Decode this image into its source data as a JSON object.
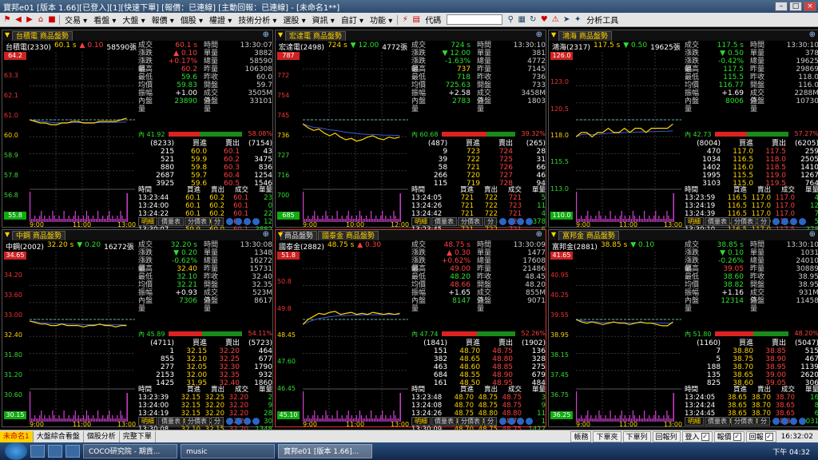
{
  "window": {
    "title": "寶邦e01 [版本 1.66][已登入][1][快速下單] [報價：已連線] [主動回報：已連線] - [未命名1**]"
  },
  "menu": {
    "items": [
      "交易",
      "看盤",
      "大盤",
      "報價",
      "個股",
      "權證",
      "技術分析",
      "選股",
      "資訊",
      "自訂",
      "功能"
    ],
    "code_label": "代碼",
    "analysis_tools": "分析工具"
  },
  "panels": [
    {
      "header": [
        "台積電 商品盤勢"
      ],
      "info": {
        "name": "台積電(2330)",
        "price": "60.1 s",
        "change": "▲ 0.10",
        "volume": "58590張",
        "dir": "up"
      },
      "y_labels": [
        "64.2",
        "63.3",
        "62.1",
        "61.0",
        "60.0",
        "58.9",
        "57.8",
        "56.8",
        "55.8"
      ],
      "x_labels": [
        "9:00",
        "11:00",
        "13:00"
      ],
      "quote": [
        [
          "成交",
          "60.1 s",
          "r",
          "時間",
          "13:30:07"
        ],
        [
          "漲跌",
          "▲ 0.10",
          "r",
          "單量",
          "3882"
        ],
        [
          "漲跌幅",
          "+0.17%",
          "r",
          "總量",
          "58590"
        ],
        [
          "最高",
          "60.2",
          "r",
          "昨量",
          "106308"
        ],
        [
          "最低",
          "59.6",
          "g",
          "昨收",
          "60.0"
        ],
        [
          "均價",
          "59.83",
          "g",
          "開盤",
          "59.7"
        ],
        [
          "振幅",
          "+1.00",
          "w",
          "成交值",
          "3505M"
        ],
        [
          "內盤量",
          "23890",
          "g",
          "外盤量",
          "33101"
        ]
      ],
      "ratio": {
        "left": "41.92",
        "right": "58.08%",
        "fill": 0.42
      },
      "orderbook": [
        [
          "(8233)",
          "買進",
          "賣出",
          "(7154)"
        ],
        [
          "215",
          "60.0",
          "60.1",
          "43"
        ],
        [
          "521",
          "59.9",
          "60.2",
          "3475"
        ],
        [
          "880",
          "59.8",
          "60.3",
          "836"
        ],
        [
          "2687",
          "59.7",
          "60.4",
          "1254"
        ],
        [
          "3925",
          "59.6",
          "60.5",
          "1546"
        ]
      ],
      "ticks_header": [
        "時間",
        "買進",
        "賣出",
        "成交",
        "單量"
      ],
      "ticks": [
        [
          "13:23:44",
          "60.1",
          "60.2",
          "60.1",
          "23"
        ],
        [
          "13:24:00",
          "60.1",
          "60.2",
          "60.1",
          "0"
        ],
        [
          "13:24:22",
          "60.1",
          "60.2",
          "60.1",
          "22"
        ],
        [
          "13:24:42",
          "60.0",
          "60.1",
          "60.1",
          "12"
        ],
        [
          "13:30:07",
          "59.9",
          "60.0",
          "60.1",
          "3882"
        ]
      ],
      "series": [
        60.0,
        59.9,
        59.8,
        59.8,
        59.7,
        59.7,
        59.8,
        59.8,
        59.9,
        59.9,
        59.8,
        59.8,
        59.8,
        59.9,
        59.9,
        59.9,
        59.9,
        60.0,
        60.1
      ],
      "ref": 60.0,
      "ymin": 55.8,
      "ymax": 64.2,
      "active": false
    },
    {
      "header": [
        "宏達電 商品盤勢"
      ],
      "info": {
        "name": "宏達電(2498)",
        "price": "724 s",
        "change": "▼ 12.00",
        "volume": "4772張",
        "dir": "down"
      },
      "y_labels": [
        "787",
        "772",
        "754",
        "745",
        "736",
        "727",
        "716",
        "700",
        "685"
      ],
      "x_labels": [
        "9:00",
        "10:00",
        "12:00"
      ],
      "quote": [
        [
          "成交",
          "724 s",
          "g",
          "時間",
          "13:30:10"
        ],
        [
          "漲跌",
          "▼ 12.00",
          "g",
          "單量",
          "381"
        ],
        [
          "漲跌幅",
          "-1.63%",
          "g",
          "總量",
          "4772"
        ],
        [
          "最高",
          "737",
          "y",
          "昨量",
          "7145"
        ],
        [
          "最低",
          "718",
          "g",
          "昨收",
          "736"
        ],
        [
          "均價",
          "725.63",
          "g",
          "開盤",
          "733"
        ],
        [
          "振幅",
          "+2.58",
          "w",
          "成交值",
          "3458M"
        ],
        [
          "內盤量",
          "2783",
          "g",
          "外盤量",
          "1803"
        ]
      ],
      "ratio": {
        "left": "60.68",
        "right": "39.32%",
        "fill": 0.61
      },
      "orderbook": [
        [
          "(487)",
          "買進",
          "賣出",
          "(265)"
        ],
        [
          "9",
          "723",
          "724",
          "28"
        ],
        [
          "39",
          "722",
          "725",
          "31"
        ],
        [
          "58",
          "721",
          "726",
          "66"
        ],
        [
          "266",
          "720",
          "727",
          "46"
        ],
        [
          "115",
          "719",
          "728",
          "94"
        ]
      ],
      "ticks_header": [
        "時間",
        "買進",
        "賣出",
        "成交",
        "單量"
      ],
      "ticks": [
        [
          "13:24:05",
          "721",
          "722",
          "721",
          "5"
        ],
        [
          "13:24:26",
          "721",
          "722",
          "723",
          "11"
        ],
        [
          "13:24:42",
          "721",
          "722",
          "721",
          "4"
        ],
        [
          "13:30:10",
          "722",
          "723",
          "723",
          "378"
        ],
        [
          "13:23:45",
          "721",
          "722",
          "721",
          "6"
        ]
      ],
      "series": [
        733,
        730,
        728,
        729,
        726,
        724,
        726,
        723,
        721,
        722,
        720,
        721,
        723,
        724,
        722,
        721,
        723,
        722,
        723
      ],
      "ref": 736,
      "ymin": 685,
      "ymax": 787,
      "active": false
    },
    {
      "header": [
        "鴻海 商品盤勢"
      ],
      "info": {
        "name": "鴻海(2317)",
        "price": "117.5 s",
        "change": "▼ 0.50",
        "volume": "19625張",
        "dir": "down"
      },
      "y_labels": [
        "126.0",
        "123.0",
        "120.5",
        "118.0",
        "115.5",
        "113.0",
        "110.0"
      ],
      "x_labels": [
        "9:00",
        "11:00",
        "13:00"
      ],
      "quote": [
        [
          "成交",
          "117.5 s",
          "g",
          "時間",
          "13:30:10"
        ],
        [
          "漲跌",
          "▼ 0.50",
          "g",
          "單量",
          "378"
        ],
        [
          "漲跌幅",
          "-0.42%",
          "g",
          "總量",
          "19625"
        ],
        [
          "最高",
          "117.5",
          "g",
          "昨量",
          "29869"
        ],
        [
          "最低",
          "115.5",
          "g",
          "昨收",
          "118.0"
        ],
        [
          "均價",
          "116.77",
          "g",
          "開盤",
          "116.0"
        ],
        [
          "振幅",
          "+1.69",
          "w",
          "成交值",
          "2288M"
        ],
        [
          "內盤量",
          "8006",
          "g",
          "外盤量",
          "10730"
        ]
      ],
      "ratio": {
        "left": "42.73",
        "right": "57.27%",
        "fill": 0.43
      },
      "orderbook": [
        [
          "(8004)",
          "買進",
          "賣出",
          "(6205)"
        ],
        [
          "470",
          "117.0",
          "117.5",
          "259"
        ],
        [
          "1034",
          "116.5",
          "118.0",
          "2505"
        ],
        [
          "1402",
          "116.0",
          "118.5",
          "1410"
        ],
        [
          "1995",
          "115.5",
          "119.0",
          "1267"
        ],
        [
          "3103",
          "115.0",
          "119.5",
          "764"
        ]
      ],
      "ticks_header": [
        "時間",
        "買進",
        "賣出",
        "成交",
        "單量"
      ],
      "ticks": [
        [
          "13:23:59",
          "116.5",
          "117.0",
          "117.0",
          "4"
        ],
        [
          "13:24:19",
          "116.5",
          "117.0",
          "117.0",
          "12"
        ],
        [
          "13:24:39",
          "116.5",
          "117.0",
          "117.0",
          "7"
        ],
        [
          "13:24:59",
          "116.5",
          "117.0",
          "117.0",
          "5"
        ],
        [
          "13:30:10",
          "116.5",
          "117.0",
          "117.5",
          "378"
        ]
      ],
      "series": [
        116.0,
        116.5,
        116.5,
        116.0,
        116.5,
        116.5,
        117.0,
        116.5,
        116.5,
        117.0,
        116.5,
        117.0,
        117.0,
        116.5,
        117.0,
        117.0,
        117.0,
        117.0,
        117.5
      ],
      "ref": 118.0,
      "ymin": 110.0,
      "ymax": 126.0,
      "active": false
    },
    {
      "header": [
        "中鋼 商品盤勢"
      ],
      "info": {
        "name": "中鋼(2002)",
        "price": "32.20 s",
        "change": "▼ 0.20",
        "volume": "16272張",
        "dir": "down"
      },
      "y_labels": [
        "34.65",
        "34.20",
        "33.60",
        "33.00",
        "32.40",
        "31.80",
        "31.20",
        "30.60",
        "30.15"
      ],
      "x_labels": [
        "9:00",
        "11:00",
        "13:00"
      ],
      "quote": [
        [
          "成交",
          "32.20 s",
          "g",
          "時間",
          "13:30:08"
        ],
        [
          "漲跌",
          "▼ 0.20",
          "g",
          "單量",
          "1348"
        ],
        [
          "漲跌幅",
          "-0.62%",
          "g",
          "總量",
          "16272"
        ],
        [
          "最高",
          "32.40",
          "y",
          "昨量",
          "15731"
        ],
        [
          "最低",
          "32.10",
          "g",
          "昨收",
          "32.40"
        ],
        [
          "均價",
          "32.21",
          "g",
          "開盤",
          "32.35"
        ],
        [
          "振幅",
          "+0.93",
          "w",
          "成交值",
          "523M"
        ],
        [
          "內盤量",
          "7306",
          "g",
          "外盤量",
          "8617"
        ]
      ],
      "ratio": {
        "left": "45.89",
        "right": "54.11%",
        "fill": 0.46
      },
      "orderbook": [
        [
          "(4711)",
          "買進",
          "賣出",
          "(5723)"
        ],
        [
          "1",
          "32.15",
          "32.20",
          "464"
        ],
        [
          "855",
          "32.10",
          "32.25",
          "677"
        ],
        [
          "277",
          "32.05",
          "32.30",
          "1790"
        ],
        [
          "2153",
          "32.00",
          "32.35",
          "932"
        ],
        [
          "1425",
          "31.95",
          "32.40",
          "1860"
        ]
      ],
      "ticks_header": [
        "時間",
        "買進",
        "賣出",
        "成交",
        "單量"
      ],
      "ticks": [
        [
          "13:23:39",
          "32.15",
          "32.25",
          "32.20",
          "2"
        ],
        [
          "13:24:00",
          "32.15",
          "32.20",
          "32.20",
          "9"
        ],
        [
          "13:24:19",
          "32.15",
          "32.20",
          "32.20",
          "28"
        ],
        [
          "13:24:41",
          "32.10",
          "32.15",
          "32.20",
          "30"
        ],
        [
          "13:30:08",
          "32.10",
          "32.15",
          "32.20",
          "1348"
        ]
      ],
      "series": [
        32.35,
        32.3,
        32.25,
        32.25,
        32.2,
        32.2,
        32.25,
        32.2,
        32.2,
        32.2,
        32.15,
        32.2,
        32.2,
        32.25,
        32.2,
        32.2,
        32.15,
        32.2,
        32.2
      ],
      "ref": 32.4,
      "ymin": 30.15,
      "ymax": 34.65,
      "active": false
    },
    {
      "header": [
        "商品盤勢",
        "國泰金 商品盤勢"
      ],
      "info": {
        "name": "國泰金(2882)",
        "price": "48.75 s",
        "change": "▲ 0.30",
        "volume": "",
        "dir": "up"
      },
      "y_labels": [
        "51.8",
        "50.8",
        "49.8",
        "48.45",
        "47.60",
        "46.45",
        "45.10"
      ],
      "x_labels": [
        "9:00",
        "11:00",
        "13:00"
      ],
      "quote": [
        [
          "成交",
          "48.75 s",
          "r",
          "時間",
          "13:30:09"
        ],
        [
          "漲跌",
          "▲ 0.30",
          "r",
          "單量",
          "1477"
        ],
        [
          "漲跌幅",
          "+0.62%",
          "r",
          "總量",
          "17608"
        ],
        [
          "最高",
          "49.00",
          "r",
          "昨量",
          "21486"
        ],
        [
          "最低",
          "48.20",
          "g",
          "昨收",
          "48.45"
        ],
        [
          "均價",
          "48.66",
          "r",
          "開盤",
          "48.20"
        ],
        [
          "振幅",
          "+1.65",
          "w",
          "成交值",
          "855M"
        ],
        [
          "內盤量",
          "8147",
          "g",
          "外盤量",
          "9071"
        ]
      ],
      "ratio": {
        "left": "47.74",
        "right": "52.26%",
        "fill": 0.48
      },
      "orderbook": [
        [
          "(1841)",
          "買進",
          "賣出",
          "(1902)"
        ],
        [
          "151",
          "48.70",
          "48.75",
          "136"
        ],
        [
          "382",
          "48.65",
          "48.80",
          "328"
        ],
        [
          "463",
          "48.60",
          "48.85",
          "275"
        ],
        [
          "684",
          "48.55",
          "48.90",
          "679"
        ],
        [
          "161",
          "48.50",
          "48.95",
          "484"
        ]
      ],
      "ticks_header": [
        "時間",
        "買進",
        "賣出",
        "成交",
        "單量"
      ],
      "ticks": [
        [
          "13:23:48",
          "48.70",
          "48.75",
          "48.75",
          "3"
        ],
        [
          "13:24:08",
          "48.70",
          "48.75",
          "48.75",
          "9"
        ],
        [
          "13:24:26",
          "48.75",
          "48.80",
          "48.80",
          "11"
        ],
        [
          "13:24:46",
          "48.70",
          "48.75",
          "48.75",
          "1"
        ],
        [
          "13:30:09",
          "48.70",
          "48.75",
          "48.75",
          "1477"
        ]
      ],
      "series": [
        48.2,
        48.45,
        48.6,
        48.75,
        48.7,
        48.8,
        48.85,
        48.7,
        48.75,
        48.8,
        48.7,
        48.75,
        48.7,
        48.8,
        48.75,
        48.7,
        48.75,
        48.7,
        48.75
      ],
      "ref": 48.45,
      "ymin": 45.1,
      "ymax": 51.8,
      "active": true
    },
    {
      "header": [
        "富邦金 商品盤勢"
      ],
      "info": {
        "name": "富邦金(2881)",
        "price": "38.85 s",
        "change": "▼ 0.10",
        "volume": "",
        "dir": "down"
      },
      "y_labels": [
        "41.65",
        "40.95",
        "40.25",
        "39.55",
        "38.95",
        "38.15",
        "37.45",
        "36.75",
        "36.25"
      ],
      "x_labels": [
        "9:00",
        "11:00",
        "13:00"
      ],
      "quote": [
        [
          "成交",
          "38.85 s",
          "g",
          "時間",
          "13:30:10"
        ],
        [
          "漲跌",
          "▼ 0.10",
          "g",
          "單量",
          "1031"
        ],
        [
          "漲跌幅",
          "-0.26%",
          "g",
          "總量",
          "24010"
        ],
        [
          "最高",
          "39.05",
          "r",
          "昨量",
          "30889"
        ],
        [
          "最低",
          "38.60",
          "g",
          "昨收",
          "38.95"
        ],
        [
          "均價",
          "38.82",
          "g",
          "開盤",
          "38.95"
        ],
        [
          "振幅",
          "+1.16",
          "w",
          "成交值",
          "931M"
        ],
        [
          "內盤量",
          "12314",
          "g",
          "外盤量",
          "11458"
        ]
      ],
      "ratio": {
        "left": "51.80",
        "right": "48.20%",
        "fill": 0.52
      },
      "orderbook": [
        [
          "(1160)",
          "買進",
          "賣出",
          "(5047)"
        ],
        [
          "7",
          "38.80",
          "38.85",
          "515"
        ],
        [
          "5",
          "38.75",
          "38.90",
          "467"
        ],
        [
          "188",
          "38.70",
          "38.95",
          "1139"
        ],
        [
          "135",
          "38.65",
          "39.00",
          "2620"
        ],
        [
          "825",
          "38.60",
          "39.05",
          "306"
        ]
      ],
      "ticks_header": [
        "時間",
        "買進",
        "賣出",
        "成交",
        "單量"
      ],
      "ticks": [
        [
          "13:24:05",
          "38.65",
          "38.70",
          "38.70",
          "16"
        ],
        [
          "13:24:24",
          "38.65",
          "38.70",
          "38.65",
          "8"
        ],
        [
          "13:24:45",
          "38.65",
          "38.70",
          "38.65",
          "6"
        ],
        [
          "13:30:10",
          "38.80",
          "38.85",
          "38.85",
          "1031"
        ]
      ],
      "series": [
        38.95,
        38.85,
        38.8,
        38.85,
        38.8,
        38.75,
        38.8,
        38.85,
        38.8,
        38.8,
        38.75,
        38.8,
        38.85,
        38.8,
        38.8,
        38.75,
        38.7,
        38.7,
        38.85
      ],
      "ref": 38.95,
      "ymin": 36.25,
      "ymax": 41.65,
      "active": false
    }
  ],
  "panel_tabs": [
    "明細",
    "價量表",
    "分價表",
    "分"
  ],
  "bottom": {
    "tabs": [
      "未命名1",
      "大盤綜合看盤",
      "個股分析",
      "完整下單"
    ],
    "right_buttons": [
      "帳務",
      "下單夾",
      "下單列",
      "回報列"
    ],
    "login_label": "登入",
    "quote_label": "報價",
    "report_label": "回報",
    "clock": "16:32:02"
  },
  "taskbar": {
    "tasks": [
      "COCO研究院 - 期貨...",
      "music",
      "寶邦e01 [版本 1.66]..."
    ],
    "tray_time": "下午 04:32"
  }
}
